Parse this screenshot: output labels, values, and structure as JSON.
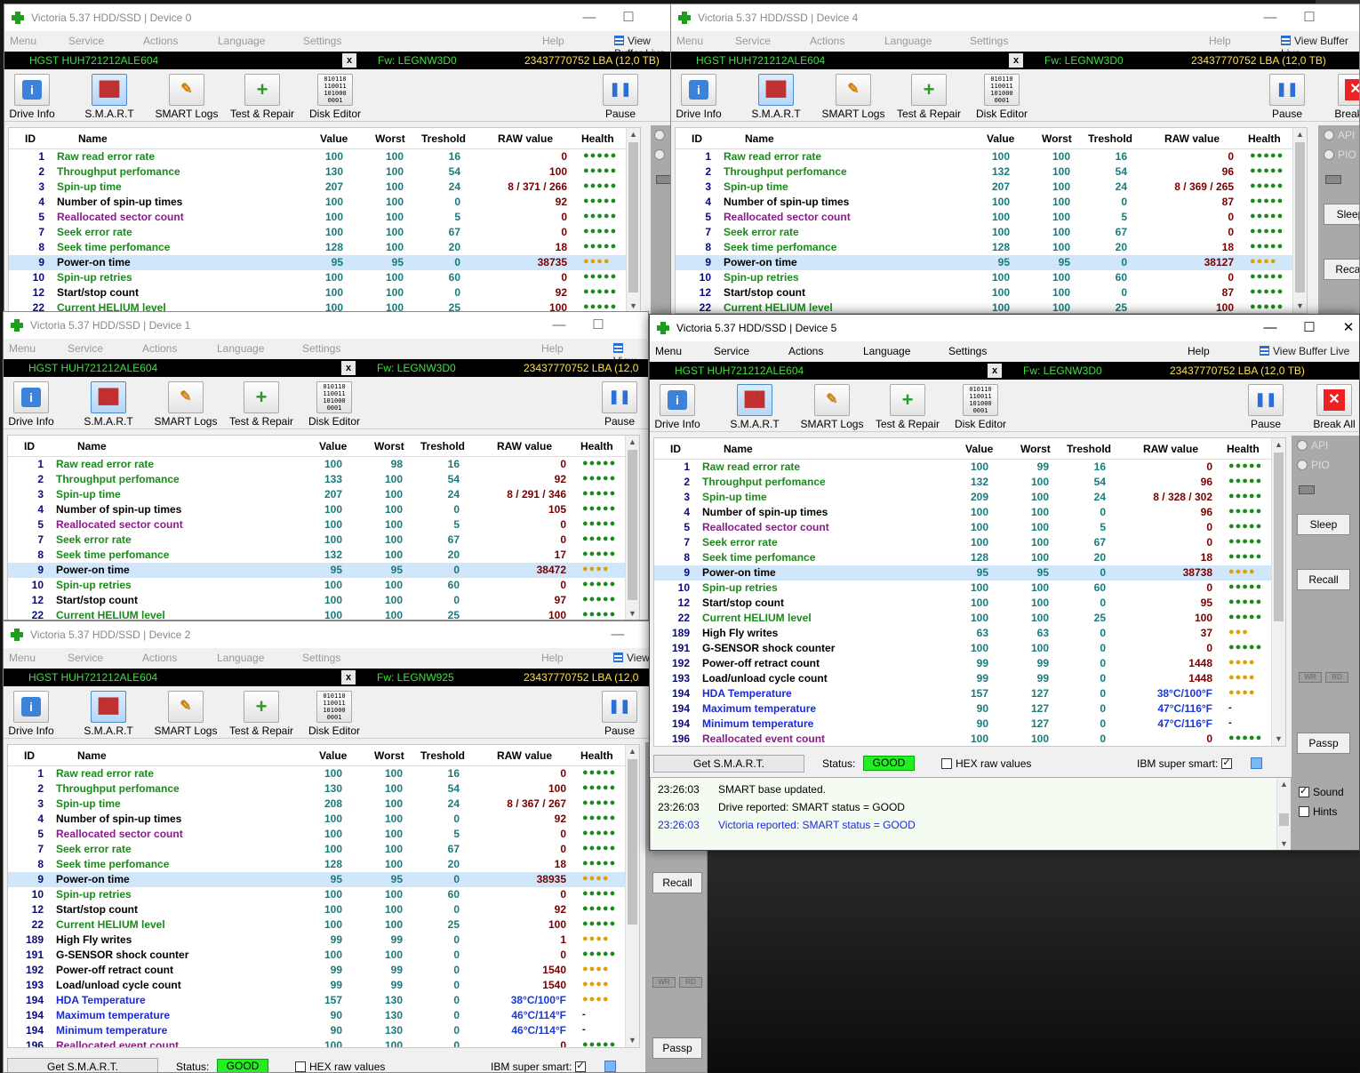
{
  "common": {
    "close_label": "x",
    "minimize": "—",
    "maximize": "☐",
    "close_x": "✕",
    "menu": {
      "menu": "Menu",
      "service": "Service",
      "actions": "Actions",
      "language": "Language",
      "settings": "Settings",
      "help": "Help",
      "view_buffer": "View Buffer Live"
    },
    "toolbar": {
      "drive_info": "Drive Info",
      "smart": "S.M.A.R.T",
      "smart_logs": "SMART Logs",
      "test_repair": "Test & Repair",
      "disk_editor": "Disk Editor",
      "pause": "Pause",
      "break_all": "Break All"
    },
    "grid_headers": {
      "id": "ID",
      "name": "Name",
      "value": "Value",
      "worst": "Worst",
      "threshold": "Treshold",
      "raw": "RAW value",
      "health": "Health"
    },
    "side": {
      "api": "API",
      "pio": "PIO",
      "sleep": "Sleep",
      "recall": "Recall",
      "passp": "Passp",
      "wr": "WR",
      "rd": "RD",
      "sound": "Sound",
      "hints": "Hints"
    },
    "status": {
      "get_smart": "Get S.M.A.R.T.",
      "status_label": "Status:",
      "status_value": "GOOD",
      "hex": "HEX raw values",
      "ibm": "IBM super smart:"
    },
    "disk_editor_bits": "010110\n110011\n101000\n0001"
  },
  "windows": [
    {
      "key": "d0",
      "title": "Victoria 5.37 HDD/SSD | Device 0",
      "model": "HGST HUH721212ALE604",
      "fw": "Fw: LEGNW3D0",
      "lba": "23437770752 LBA (12,0 TB)",
      "rows": [
        [
          "1",
          "Raw read error rate",
          "100",
          "100",
          "16",
          "0",
          "g5",
          "green"
        ],
        [
          "2",
          "Throughput perfomance",
          "130",
          "100",
          "54",
          "100",
          "g5",
          "green"
        ],
        [
          "3",
          "Spin-up time",
          "207",
          "100",
          "24",
          "8 / 371 / 266",
          "g5",
          "green"
        ],
        [
          "4",
          "Number of spin-up times",
          "100",
          "100",
          "0",
          "92",
          "g5",
          "black"
        ],
        [
          "5",
          "Reallocated sector count",
          "100",
          "100",
          "5",
          "0",
          "g5",
          "purple"
        ],
        [
          "7",
          "Seek error rate",
          "100",
          "100",
          "67",
          "0",
          "g5",
          "green"
        ],
        [
          "8",
          "Seek time perfomance",
          "128",
          "100",
          "20",
          "18",
          "g5",
          "green"
        ],
        [
          "9",
          "Power-on time",
          "95",
          "95",
          "0",
          "38735",
          "w4",
          "black"
        ],
        [
          "10",
          "Spin-up retries",
          "100",
          "100",
          "60",
          "0",
          "g5",
          "green"
        ],
        [
          "12",
          "Start/stop count",
          "100",
          "100",
          "0",
          "92",
          "g5",
          "black"
        ],
        [
          "22",
          "Current HELIUM level",
          "100",
          "100",
          "25",
          "100",
          "g5",
          "green"
        ]
      ]
    },
    {
      "key": "d4",
      "title": "Victoria 5.37 HDD/SSD | Device 4",
      "model": "HGST HUH721212ALE604",
      "fw": "Fw: LEGNW3D0",
      "lba": "23437770752 LBA (12,0 TB)",
      "rows": [
        [
          "1",
          "Raw read error rate",
          "100",
          "100",
          "16",
          "0",
          "g5",
          "green"
        ],
        [
          "2",
          "Throughput perfomance",
          "132",
          "100",
          "54",
          "96",
          "g5",
          "green"
        ],
        [
          "3",
          "Spin-up time",
          "207",
          "100",
          "24",
          "8 / 369 / 265",
          "g5",
          "green"
        ],
        [
          "4",
          "Number of spin-up times",
          "100",
          "100",
          "0",
          "87",
          "g5",
          "black"
        ],
        [
          "5",
          "Reallocated sector count",
          "100",
          "100",
          "5",
          "0",
          "g5",
          "purple"
        ],
        [
          "7",
          "Seek error rate",
          "100",
          "100",
          "67",
          "0",
          "g5",
          "green"
        ],
        [
          "8",
          "Seek time perfomance",
          "128",
          "100",
          "20",
          "18",
          "g5",
          "green"
        ],
        [
          "9",
          "Power-on time",
          "95",
          "95",
          "0",
          "38127",
          "w4",
          "black"
        ],
        [
          "10",
          "Spin-up retries",
          "100",
          "100",
          "60",
          "0",
          "g5",
          "green"
        ],
        [
          "12",
          "Start/stop count",
          "100",
          "100",
          "0",
          "87",
          "g5",
          "black"
        ],
        [
          "22",
          "Current HELIUM level",
          "100",
          "100",
          "25",
          "100",
          "g5",
          "green"
        ]
      ]
    },
    {
      "key": "d1",
      "title": "Victoria 5.37 HDD/SSD | Device 1",
      "model": "HGST HUH721212ALE604",
      "fw": "Fw: LEGNW3D0",
      "lba": "23437770752 LBA (12,0",
      "rows": [
        [
          "1",
          "Raw read error rate",
          "100",
          "98",
          "16",
          "0",
          "g5",
          "green"
        ],
        [
          "2",
          "Throughput perfomance",
          "133",
          "100",
          "54",
          "92",
          "g5",
          "green"
        ],
        [
          "3",
          "Spin-up time",
          "207",
          "100",
          "24",
          "8 / 291 / 346",
          "g5",
          "green"
        ],
        [
          "4",
          "Number of spin-up times",
          "100",
          "100",
          "0",
          "105",
          "g5",
          "black"
        ],
        [
          "5",
          "Reallocated sector count",
          "100",
          "100",
          "5",
          "0",
          "g5",
          "purple"
        ],
        [
          "7",
          "Seek error rate",
          "100",
          "100",
          "67",
          "0",
          "g5",
          "green"
        ],
        [
          "8",
          "Seek time perfomance",
          "132",
          "100",
          "20",
          "17",
          "g5",
          "green"
        ],
        [
          "9",
          "Power-on time",
          "95",
          "95",
          "0",
          "38472",
          "w4",
          "black"
        ],
        [
          "10",
          "Spin-up retries",
          "100",
          "100",
          "60",
          "0",
          "g5",
          "green"
        ],
        [
          "12",
          "Start/stop count",
          "100",
          "100",
          "0",
          "97",
          "g5",
          "black"
        ],
        [
          "22",
          "Current HELIUM level",
          "100",
          "100",
          "25",
          "100",
          "g5",
          "green"
        ]
      ]
    },
    {
      "key": "d2",
      "title": "Victoria 5.37 HDD/SSD | Device 2",
      "model": "HGST HUH721212ALE604",
      "fw": "Fw: LEGNW925",
      "lba": "23437770752 LBA (12,0",
      "rows": [
        [
          "1",
          "Raw read error rate",
          "100",
          "100",
          "16",
          "0",
          "g5",
          "green"
        ],
        [
          "2",
          "Throughput perfomance",
          "130",
          "100",
          "54",
          "100",
          "g5",
          "green"
        ],
        [
          "3",
          "Spin-up time",
          "208",
          "100",
          "24",
          "8 / 367 / 267",
          "g5",
          "green"
        ],
        [
          "4",
          "Number of spin-up times",
          "100",
          "100",
          "0",
          "92",
          "g5",
          "black"
        ],
        [
          "5",
          "Reallocated sector count",
          "100",
          "100",
          "5",
          "0",
          "g5",
          "purple"
        ],
        [
          "7",
          "Seek error rate",
          "100",
          "100",
          "67",
          "0",
          "g5",
          "green"
        ],
        [
          "8",
          "Seek time perfomance",
          "128",
          "100",
          "20",
          "18",
          "g5",
          "green"
        ],
        [
          "9",
          "Power-on time",
          "95",
          "95",
          "0",
          "38935",
          "w4",
          "black"
        ],
        [
          "10",
          "Spin-up retries",
          "100",
          "100",
          "60",
          "0",
          "g5",
          "green"
        ],
        [
          "12",
          "Start/stop count",
          "100",
          "100",
          "0",
          "92",
          "g5",
          "black"
        ],
        [
          "22",
          "Current HELIUM level",
          "100",
          "100",
          "25",
          "100",
          "g5",
          "green"
        ],
        [
          "189",
          "High Fly writes",
          "99",
          "99",
          "0",
          "1",
          "w4",
          "black"
        ],
        [
          "191",
          "G-SENSOR shock counter",
          "100",
          "100",
          "0",
          "0",
          "g5",
          "black"
        ],
        [
          "192",
          "Power-off retract count",
          "99",
          "99",
          "0",
          "1540",
          "w4",
          "black"
        ],
        [
          "193",
          "Load/unload cycle count",
          "99",
          "99",
          "0",
          "1540",
          "w4",
          "black"
        ],
        [
          "194",
          "HDA Temperature",
          "157",
          "130",
          "0",
          "38°C/100°F",
          "w4",
          "blue"
        ],
        [
          "194",
          "Maximum temperature",
          "90",
          "130",
          "0",
          "46°C/114°F",
          "dash",
          "blue"
        ],
        [
          "194",
          "Minimum temperature",
          "90",
          "130",
          "0",
          "46°C/114°F",
          "dash",
          "blue"
        ],
        [
          "196",
          "Reallocated event count",
          "100",
          "100",
          "0",
          "0",
          "g5",
          "purple"
        ]
      ]
    },
    {
      "key": "d5",
      "title": "Victoria 5.37 HDD/SSD | Device 5",
      "model": "HGST HUH721212ALE604",
      "fw": "Fw: LEGNW3D0",
      "lba": "23437770752 LBA (12,0 TB)",
      "rows": [
        [
          "1",
          "Raw read error rate",
          "100",
          "99",
          "16",
          "0",
          "g5",
          "green"
        ],
        [
          "2",
          "Throughput perfomance",
          "132",
          "100",
          "54",
          "96",
          "g5",
          "green"
        ],
        [
          "3",
          "Spin-up time",
          "209",
          "100",
          "24",
          "8 / 328 / 302",
          "g5",
          "green"
        ],
        [
          "4",
          "Number of spin-up times",
          "100",
          "100",
          "0",
          "96",
          "g5",
          "black"
        ],
        [
          "5",
          "Reallocated sector count",
          "100",
          "100",
          "5",
          "0",
          "g5",
          "purple"
        ],
        [
          "7",
          "Seek error rate",
          "100",
          "100",
          "67",
          "0",
          "g5",
          "green"
        ],
        [
          "8",
          "Seek time perfomance",
          "128",
          "100",
          "20",
          "18",
          "g5",
          "green"
        ],
        [
          "9",
          "Power-on time",
          "95",
          "95",
          "0",
          "38738",
          "w4",
          "black"
        ],
        [
          "10",
          "Spin-up retries",
          "100",
          "100",
          "60",
          "0",
          "g5",
          "green"
        ],
        [
          "12",
          "Start/stop count",
          "100",
          "100",
          "0",
          "95",
          "g5",
          "black"
        ],
        [
          "22",
          "Current HELIUM level",
          "100",
          "100",
          "25",
          "100",
          "g5",
          "green"
        ],
        [
          "189",
          "High Fly writes",
          "63",
          "63",
          "0",
          "37",
          "w3",
          "black"
        ],
        [
          "191",
          "G-SENSOR shock counter",
          "100",
          "100",
          "0",
          "0",
          "g5",
          "black"
        ],
        [
          "192",
          "Power-off retract count",
          "99",
          "99",
          "0",
          "1448",
          "w4",
          "black"
        ],
        [
          "193",
          "Load/unload cycle count",
          "99",
          "99",
          "0",
          "1448",
          "w4",
          "black"
        ],
        [
          "194",
          "HDA Temperature",
          "157",
          "127",
          "0",
          "38°C/100°F",
          "w4",
          "blue"
        ],
        [
          "194",
          "Maximum temperature",
          "90",
          "127",
          "0",
          "47°C/116°F",
          "dash",
          "blue"
        ],
        [
          "194",
          "Minimum temperature",
          "90",
          "127",
          "0",
          "47°C/116°F",
          "dash",
          "blue"
        ],
        [
          "196",
          "Reallocated event count",
          "100",
          "100",
          "0",
          "0",
          "g5",
          "purple"
        ]
      ],
      "log": [
        {
          "time": "23:26:03",
          "text": "SMART base updated.",
          "color": "#000"
        },
        {
          "time": "23:26:03",
          "text": "Drive reported: SMART status = GOOD",
          "color": "#000"
        },
        {
          "time": "23:26:03",
          "text": "Victoria reported: SMART status = GOOD",
          "color": "#1a2ad6"
        }
      ]
    }
  ],
  "health_glyphs": {
    "g5": "●●●●●",
    "w4": "●●●●",
    "w3": "●●●",
    "dash": "-"
  }
}
